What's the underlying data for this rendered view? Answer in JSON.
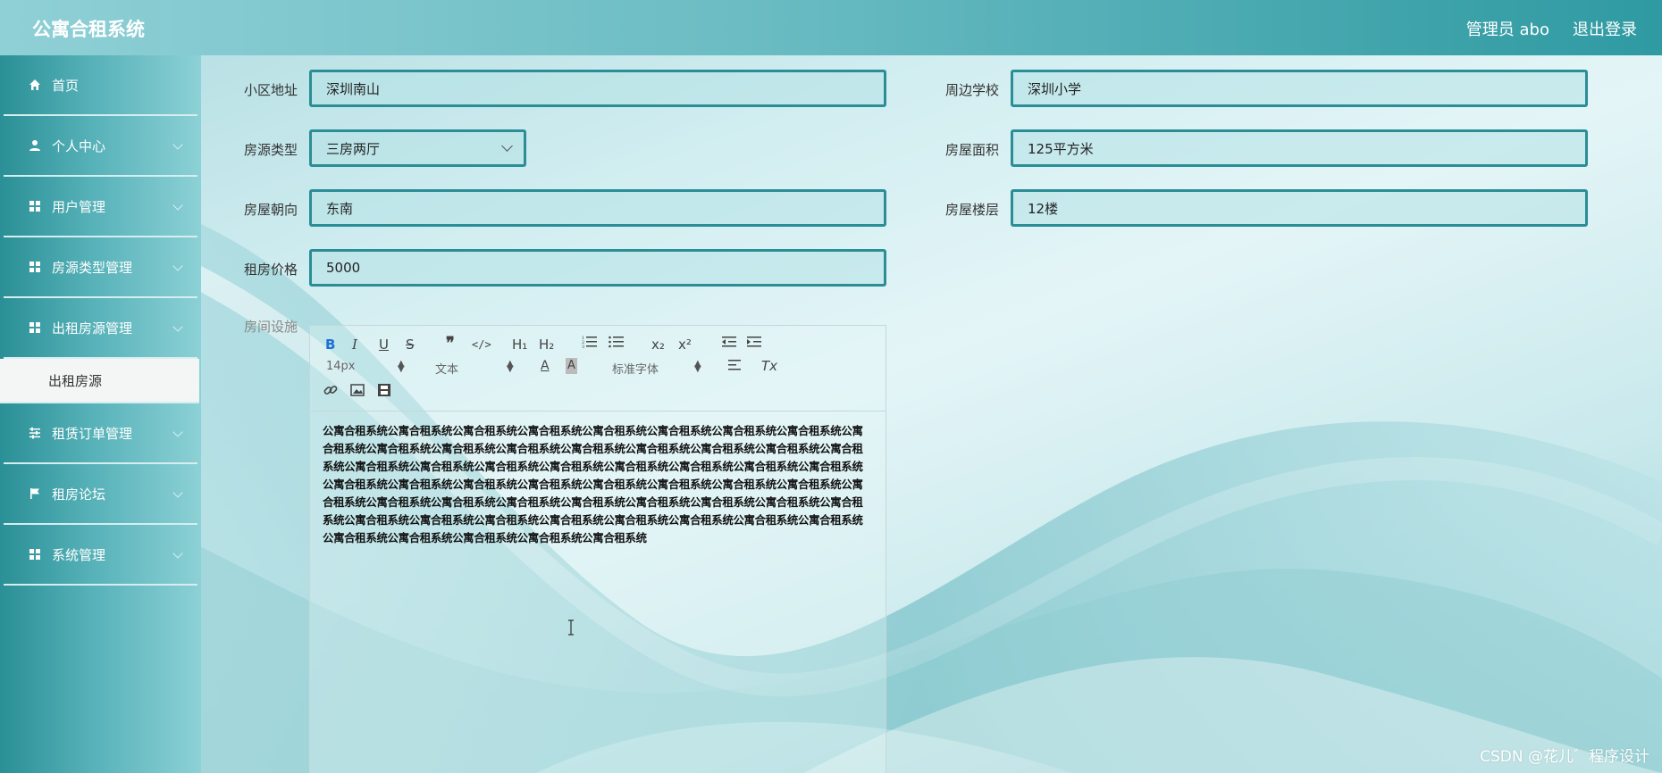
{
  "header": {
    "app_title": "公寓合租系统",
    "user_label": "管理员 abo",
    "logout_label": "退出登录"
  },
  "sidebar": {
    "items": [
      {
        "label": "首页",
        "icon": "home-icon"
      },
      {
        "label": "个人中心",
        "icon": "user-icon"
      },
      {
        "label": "用户管理",
        "icon": "grid-icon"
      },
      {
        "label": "房源类型管理",
        "icon": "grid-icon"
      },
      {
        "label": "出租房源管理",
        "icon": "grid-icon"
      },
      {
        "label": "租赁订单管理",
        "icon": "sliders-icon"
      },
      {
        "label": "租房论坛",
        "icon": "flag-icon"
      },
      {
        "label": "系统管理",
        "icon": "grid-icon"
      }
    ],
    "active_submenu": "出租房源"
  },
  "form": {
    "address": {
      "label": "小区地址",
      "value": "深圳南山"
    },
    "school": {
      "label": "周边学校",
      "value": "深圳小学"
    },
    "type": {
      "label": "房源类型",
      "value": "三房两厅"
    },
    "area": {
      "label": "房屋面积",
      "value": "125平方米"
    },
    "orientation": {
      "label": "房屋朝向",
      "value": "东南"
    },
    "floor": {
      "label": "房屋楼层",
      "value": "12楼"
    },
    "price": {
      "label": "租房价格",
      "value": "5000"
    },
    "facilities": {
      "label": "房间设施"
    }
  },
  "editor": {
    "toolbar": {
      "bold": "B",
      "italic": "I",
      "underline": "U",
      "strike": "S",
      "h1": "H₁",
      "h2": "H₂",
      "sub": "x₂",
      "sup": "x²",
      "size": "14px",
      "header_select": "文本",
      "font_select": "标准字体",
      "clean": "Tx"
    },
    "content": "公寓合租系统公寓合租系统公寓合租系统公寓合租系统公寓合租系统公寓合租系统公寓合租系统公寓合租系统公寓合租系统公寓合租系统公寓合租系统公寓合租系统公寓合租系统公寓合租系统公寓合租系统公寓合租系统公寓合租系统公寓合租系统公寓合租系统公寓合租系统公寓合租系统公寓合租系统公寓合租系统公寓合租系统公寓合租系统公寓合租系统公寓合租系统公寓合租系统公寓合租系统公寓合租系统公寓合租系统公寓合租系统公寓合租系统公寓合租系统公寓合租系统公寓合租系统公寓合租系统公寓合租系统公寓合租系统公寓合租系统公寓合租系统公寓合租系统公寓合租系统公寓合租系统公寓合租系统公寓合租系统公寓合租系统公寓合租系统公寓合租系统公寓合租系统公寓合租系统公寓合租系统公寓合租系统公寓合租系统公寓合租系统"
  },
  "watermark": "CSDN @花儿゛程序设计",
  "colors": {
    "accent": "#2b8d95",
    "header_start": "#8fd0d6",
    "header_end": "#2f9aa2",
    "sidebar": "#4aa8af"
  }
}
